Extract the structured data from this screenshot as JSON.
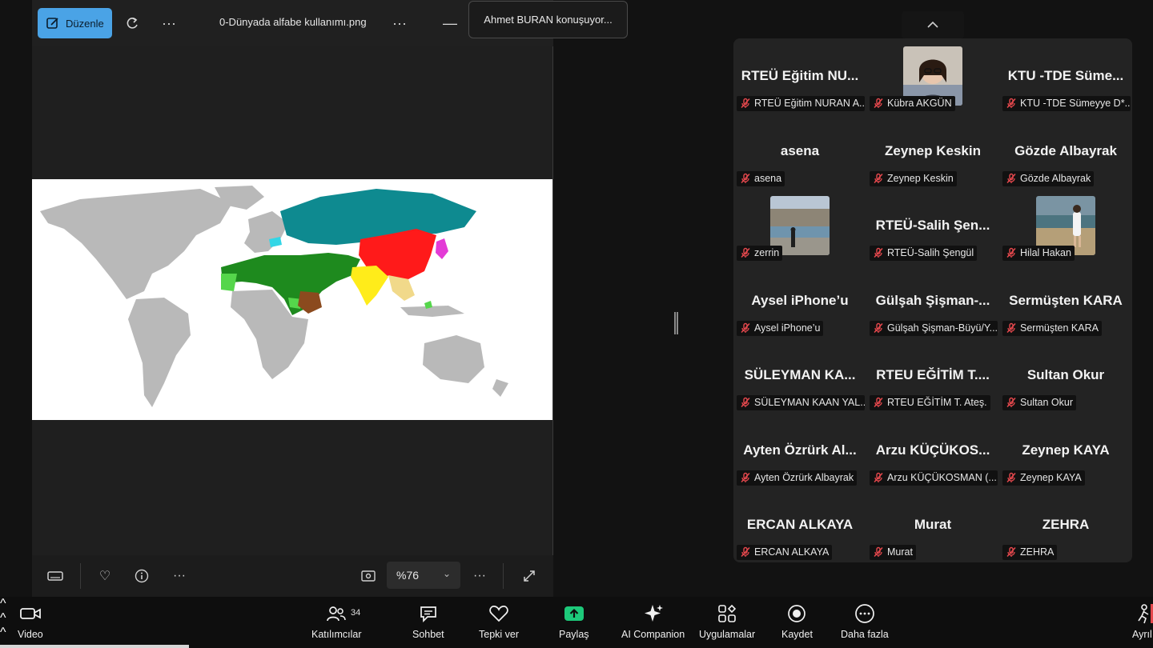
{
  "viewer": {
    "edit_label": "Düzenle",
    "file_name": "0-Dünyada alfabe kullanımı.png",
    "zoom": "%76"
  },
  "speaker": "Ahmet BURAN konuşuyor...",
  "participants": [
    {
      "display": "RTEÜ  Eğitim  NU...",
      "label": "RTEÜ Eğitim NURAN A...",
      "photo": false
    },
    {
      "display": "",
      "label": "Kübra AKGÜN",
      "photo": true
    },
    {
      "display": "KTU  -TDE  Süme...",
      "label": "KTU -TDE Sümeyye D*...",
      "photo": false
    },
    {
      "display": "asena",
      "label": "asena",
      "photo": false
    },
    {
      "display": "Zeynep Keskin",
      "label": "Zeynep Keskin",
      "photo": false
    },
    {
      "display": "Gözde Albayrak",
      "label": "Gözde Albayrak",
      "photo": false
    },
    {
      "display": "",
      "label": "zerrin",
      "photo": true
    },
    {
      "display": "RTEÜ-Salih  Şen...",
      "label": "RTEÜ-Salih Şengül",
      "photo": false
    },
    {
      "display": "",
      "label": "Hilal Hakan",
      "photo": true
    },
    {
      "display": "Aysel iPhone’u",
      "label": "Aysel iPhone’u",
      "photo": false
    },
    {
      "display": "Gülşah  Şişman-...",
      "label": "Gülşah Şişman-Büyü/Y...",
      "photo": false
    },
    {
      "display": "Sermüşten KARA",
      "label": "Sermüşten KARA",
      "photo": false
    },
    {
      "display": "SÜLEYMAN  KA...",
      "label": "SÜLEYMAN KAAN YAL...",
      "photo": false
    },
    {
      "display": "RTEU  EĞİTİM  T....",
      "label": "RTEU EĞİTİM T. Ateş.",
      "photo": false
    },
    {
      "display": "Sultan Okur",
      "label": "Sultan Okur",
      "photo": false
    },
    {
      "display": "Ayten  Özrürk  Al...",
      "label": "Ayten Özrürk Albayrak",
      "photo": false
    },
    {
      "display": "Arzu  KÜÇÜKOS...",
      "label": "Arzu KÜÇÜKOSMAN (...",
      "photo": false
    },
    {
      "display": "Zeynep KAYA",
      "label": "Zeynep KAYA",
      "photo": false
    },
    {
      "display": "ERCAN ALKAYA",
      "label": "ERCAN ALKAYA",
      "photo": false
    },
    {
      "display": "Murat",
      "label": "Murat",
      "photo": false
    },
    {
      "display": "ZEHRA",
      "label": "ZEHRA",
      "photo": false
    }
  ],
  "toolbar": {
    "video": "Video",
    "participants": "Katılımcılar",
    "participant_count": "34",
    "chat": "Sohbet",
    "react": "Tepki ver",
    "share": "Paylaş",
    "ai": "AI Companion",
    "apps": "Uygulamalar",
    "record": "Kaydet",
    "more": "Daha fazla",
    "leave": "Ayrıl"
  },
  "colors": {
    "accent_blue": "#4aa3e6",
    "share_green": "#1dc97a",
    "mic_muted": "#e5484d"
  }
}
